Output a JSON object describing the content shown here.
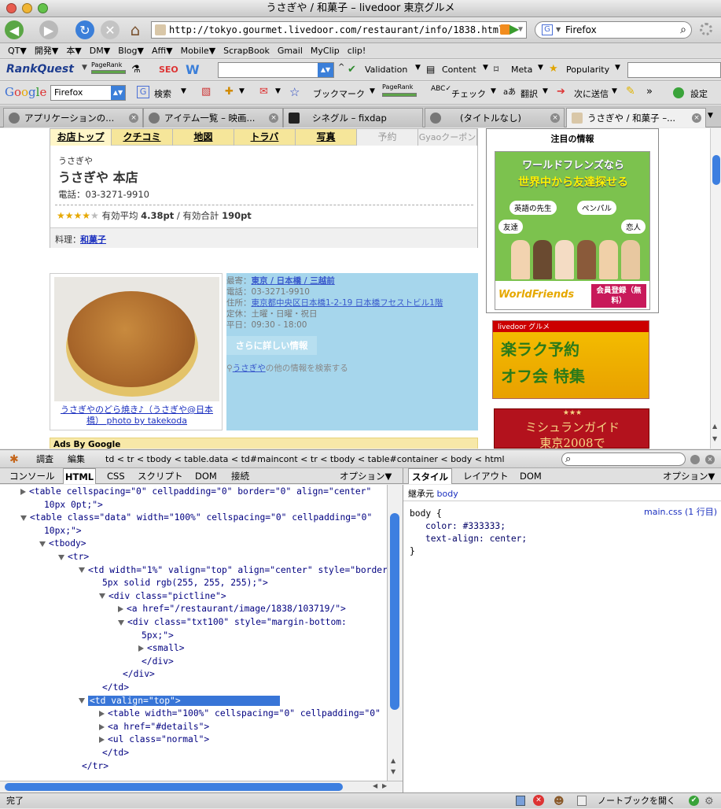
{
  "window": {
    "title": "うさぎや / 和菓子 – livedoor 東京グルメ"
  },
  "nav": {
    "url": "http://tokyo.gourmet.livedoor.com/restaurant/info/1838.html",
    "search_engine": "Firefox"
  },
  "bookmarks": [
    "QT▼",
    "開発▼",
    "本▼",
    "DM▼",
    "Blog▼",
    "Affi▼",
    "Mobile▼",
    "ScrapBook",
    "Gmail",
    "MyClip",
    "clip!"
  ],
  "rankquest": {
    "logo": "RankQuest",
    "pagerank": "PageRank",
    "seo": "SEO",
    "validation": "Validation",
    "content": "Content",
    "meta": "Meta",
    "popularity": "Popularity"
  },
  "googlebar": {
    "logo": "Google",
    "search_value": "Firefox",
    "search_btn": "検索",
    "bookmark": "ブックマーク",
    "pagerank": "PageRank",
    "check": "チェック",
    "translate": "翻訳",
    "send": "次に送信",
    "settings": "設定",
    "more": "»"
  },
  "tabs": [
    {
      "label": "アプリケーションの..."
    },
    {
      "label": "アイテム一覧 – 映画..."
    },
    {
      "label": "シネグル – fixdap"
    },
    {
      "label": "(タイトルなし)"
    },
    {
      "label": "うさぎや / 和菓子 –..."
    }
  ],
  "page": {
    "shop_tabs": [
      "お店トップ",
      "クチコミ",
      "地図",
      "トラバ",
      "写真",
      "予約",
      "Gyaoクーポン"
    ],
    "kana": "うさぎや",
    "shop_name": "うさぎや 本店",
    "phone": "電話：03-3271-9910",
    "rating_text": "有効平均",
    "rating_avg": "4.38pt",
    "rating_sep": " / 有効合計 ",
    "rating_total": "190pt",
    "stars": 4,
    "cuisine_label": "料理：",
    "cuisine": "和菓子",
    "photo_caption": "うさぎやのどら焼き♪（うさぎや@日本橋） photo by takekoda",
    "info": {
      "station_label": "最寄：",
      "station": "東京 / 日本橋 / 三越前",
      "phone": "電話：03-3271-9910",
      "address_label": "住所：",
      "address": "東京都中央区日本橋1-2-19 日本橋フセストビル1階",
      "holiday": "定休：土曜・日曜・祝日",
      "hours": "平日：09:30 - 18:00",
      "detail_btn": "さらに詳しい情報",
      "search_link": "うさぎや",
      "search_text": "の他の情報を検索する"
    },
    "ads_by": "Ads By Google",
    "side_title": "注目の情報",
    "wf_headline1": "ワールドフレンズなら",
    "wf_headline2": "世界中から友達探せる",
    "wf_bubble1": "英語の先生",
    "wf_bubble2": "ペンパル",
    "wf_bubble3": "友達",
    "wf_bubble4": "恋人",
    "wf_brand": "WorldFriends",
    "wf_btn": "会員登録（無料）",
    "ld_brand": "livedoor グルメ",
    "ld_line1": "楽ラク予約",
    "ld_line2": "オフ会 特集",
    "mg_line1": "ミシュランガイド",
    "mg_line2": "東京2008で"
  },
  "firebug": {
    "inspect": "調査",
    "edit": "編集",
    "breadcrumb": "td < tr < tbody < table.data < td#maincont < tr < tbody < table#container < body < html",
    "tabs_left": [
      "コンソール",
      "HTML",
      "CSS",
      "スクリプト",
      "DOM",
      "接続"
    ],
    "options": "オプション▼",
    "tabs_right": [
      "スタイル",
      "レイアウト",
      "DOM"
    ],
    "inherited_label": "継承元",
    "inherited_from": "body",
    "css_file": "main.css (1 行目)",
    "css_selector": "body {",
    "css_rules": [
      "color: #333333;",
      "text-align: center;"
    ],
    "css_close": "}",
    "html_lines": [
      {
        "indent": 40,
        "tw": "r",
        "text": "<table cellspacing=\"0\" cellpadding=\"0\" border=\"0\" align=\"center\""
      },
      {
        "indent": 56,
        "tw": "",
        "text": "10px 0pt;\">"
      },
      {
        "indent": 40,
        "tw": "d",
        "text": "<table class=\"data\" width=\"100%\" cellspacing=\"0\" cellpadding=\"0\""
      },
      {
        "indent": 56,
        "tw": "",
        "text": "10px;\">"
      },
      {
        "indent": 64,
        "tw": "d",
        "text": "<tbody>"
      },
      {
        "indent": 88,
        "tw": "d",
        "text": "<tr>"
      },
      {
        "indent": 114,
        "tw": "d",
        "text": "<td width=\"1%\" valign=\"top\" align=\"center\" style=\"border-right:"
      },
      {
        "indent": 130,
        "tw": "",
        "text": "5px solid rgb(255, 255, 255);\">"
      },
      {
        "indent": 140,
        "tw": "d",
        "text": "<div class=\"pictline\">"
      },
      {
        "indent": 164,
        "tw": "r",
        "text": "<a href=\"/restaurant/image/1838/103719/\">"
      },
      {
        "indent": 164,
        "tw": "d",
        "text": "<div class=\"txt100\" style=\"margin-bottom:"
      },
      {
        "indent": 180,
        "tw": "",
        "text": "5px;\">"
      },
      {
        "indent": 190,
        "tw": "r",
        "text": "<small>"
      },
      {
        "indent": 180,
        "tw": "",
        "text": "</div>"
      },
      {
        "indent": 156,
        "tw": "",
        "text": "</div>"
      },
      {
        "indent": 130,
        "tw": "",
        "text": "</td>"
      },
      {
        "indent": 114,
        "tw": "d",
        "text": "<td valign=\"top\">"
      },
      {
        "indent": 140,
        "tw": "r",
        "text": "<table width=\"100%\" cellspacing=\"0\" cellpadding=\"0\""
      },
      {
        "indent": 140,
        "tw": "r",
        "text": "<a href=\"#details\">"
      },
      {
        "indent": 140,
        "tw": "r",
        "text": "<ul class=\"normal\">"
      },
      {
        "indent": 130,
        "tw": "",
        "text": "</td>"
      },
      {
        "indent": 104,
        "tw": "",
        "text": "</tr>"
      }
    ]
  },
  "status": {
    "done": "完了",
    "notebook": "ノートブックを開く"
  }
}
